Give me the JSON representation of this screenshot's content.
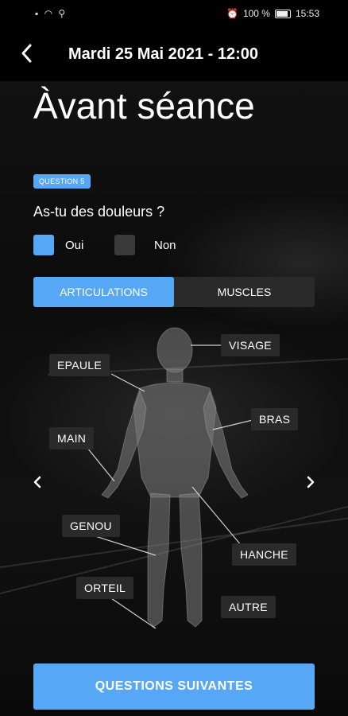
{
  "status_bar": {
    "battery_percent": "100 %",
    "time": "15:53"
  },
  "header": {
    "title": "Mardi 25 Mai 2021 - 12:00"
  },
  "page": {
    "title": "Àvant séance"
  },
  "question": {
    "badge": "QUESTION 5",
    "text": "As-tu des douleurs ?",
    "options": [
      {
        "label": "Oui",
        "selected": true
      },
      {
        "label": "Non",
        "selected": false
      }
    ]
  },
  "tabs": [
    {
      "label": "ARTICULATIONS",
      "active": true
    },
    {
      "label": "MUSCLES",
      "active": false
    }
  ],
  "body_labels": {
    "visage": "VISAGE",
    "epaule": "EPAULE",
    "bras": "BRAS",
    "main": "MAIN",
    "genou": "GENOU",
    "hanche": "HANCHE",
    "orteil": "ORTEIL",
    "autre": "AUTRE"
  },
  "cta": {
    "label": "QUESTIONS SUIVANTES"
  },
  "colors": {
    "accent": "#56a8f6",
    "panel": "#2a2a2a",
    "background": "#0b0b0b"
  },
  "icons": {
    "back": "chevron-left-icon",
    "prev": "chevron-left-icon",
    "next": "chevron-right-icon"
  }
}
